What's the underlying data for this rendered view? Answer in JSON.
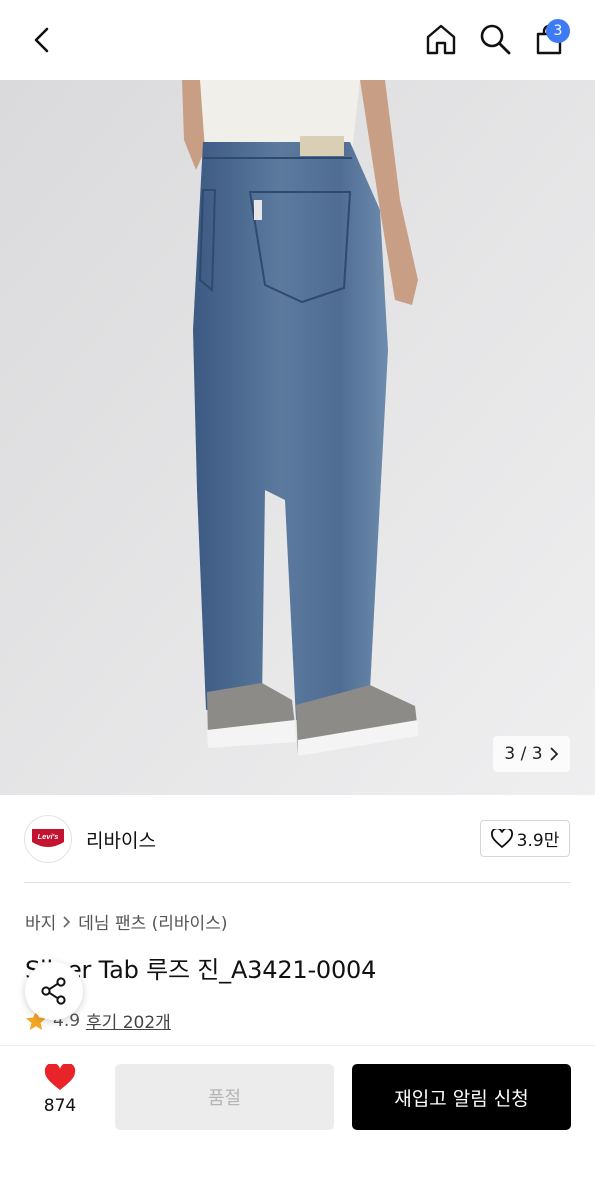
{
  "header": {
    "cart_count": "3"
  },
  "gallery": {
    "pager": "3 / 3"
  },
  "brand": {
    "name": "리바이스",
    "logo_text": "Levi's",
    "likes": "3.9만"
  },
  "breadcrumb": {
    "items": [
      "바지",
      "데님 팬츠 (리바이스)"
    ]
  },
  "product": {
    "title": "Silver Tab 루즈 진_A3421-0004",
    "rating": "4.9",
    "reviews": "후기 202개"
  },
  "actions": {
    "wish_count": "874",
    "soldout_label": "품절",
    "restock_label": "재입고 알림 신청"
  },
  "colors": {
    "accent": "#3d7bf6",
    "heart": "#e8232a",
    "star": "#f5a623"
  }
}
